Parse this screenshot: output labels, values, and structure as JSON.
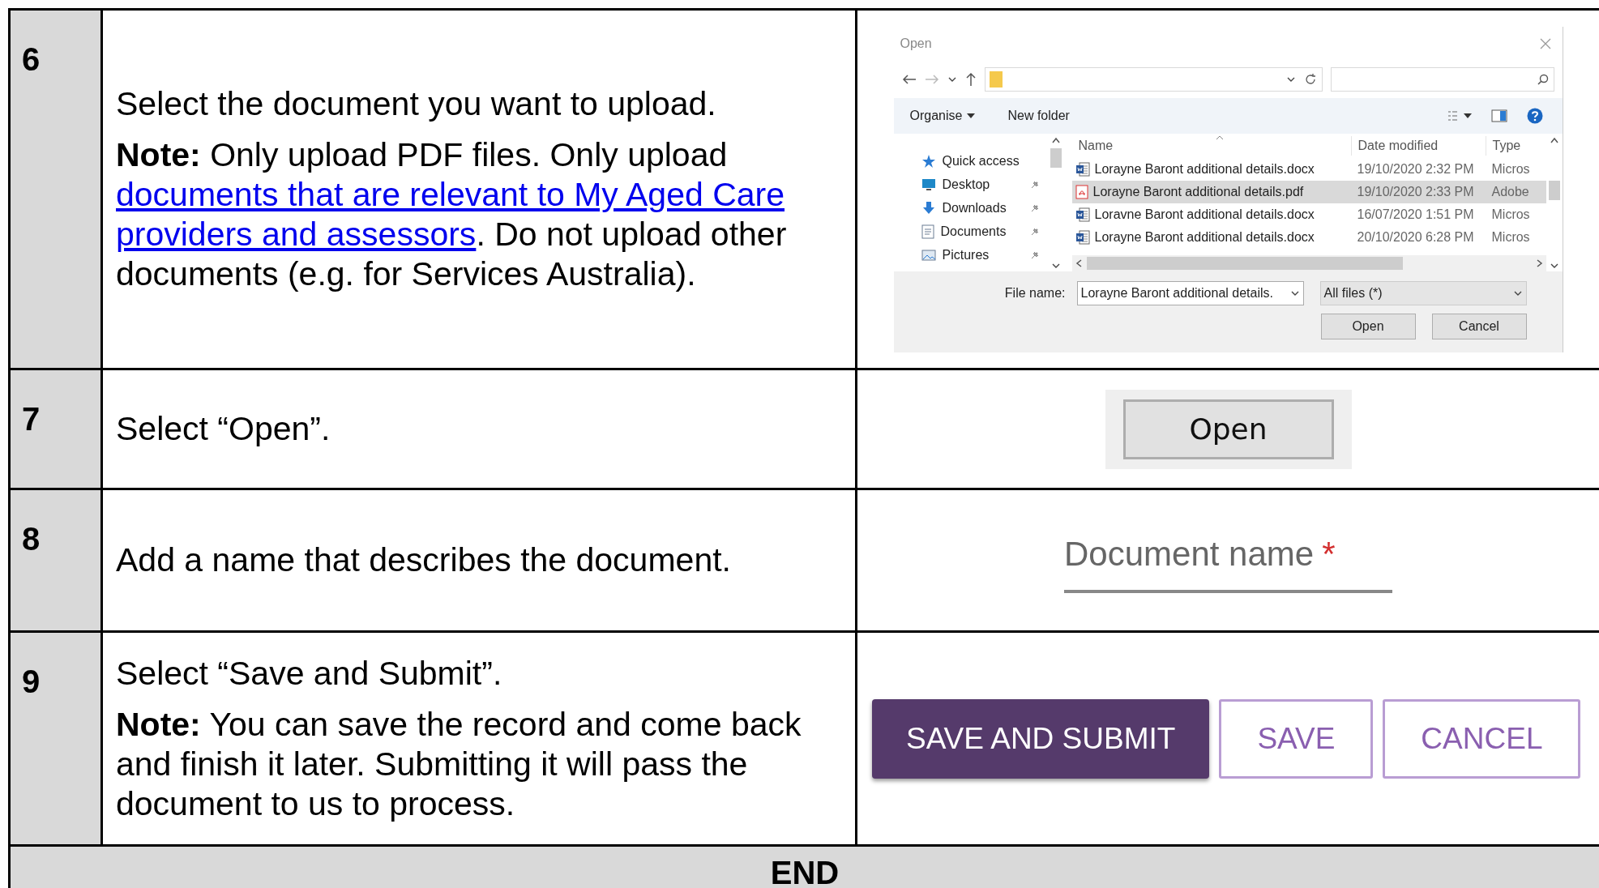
{
  "steps": [
    {
      "number": "6",
      "paragraphs": [
        [
          {
            "kind": "text",
            "text": "Select the document you want to upload."
          }
        ],
        [
          {
            "kind": "text",
            "text": "**Note:** Only upload PDF files. Only upload "
          },
          {
            "kind": "link",
            "text": "documents that are relevant to My Aged Care"
          },
          {
            "kind": "link",
            "text": "providers and assessors"
          },
          {
            "kind": "text",
            "text": ". Do not upload other documents (e.g. for Services Australia)."
          }
        ]
      ],
      "figure": {
        "kind": "file_dialog",
        "title": "Open",
        "organise": "Organise",
        "new_folder": "New folder",
        "nav": [
          {
            "label": "Quick access",
            "kind": "star",
            "pinned": false
          },
          {
            "label": "Desktop",
            "kind": "desktop",
            "pinned": true
          },
          {
            "label": "Downloads",
            "kind": "downloads",
            "pinned": true
          },
          {
            "label": "Documents",
            "kind": "documents",
            "pinned": true
          },
          {
            "label": "Pictures",
            "kind": "pictures",
            "pinned": true
          }
        ],
        "columns": [
          "Name",
          "Date modified",
          "Type"
        ],
        "files": [
          {
            "name": "Lorayne Baront additional details.docx",
            "date": "19/10/2020 2:32 PM",
            "type": "Micros",
            "kind": "docx",
            "selected": false
          },
          {
            "name": "Lorayne Baront additional details.pdf",
            "date": "19/10/2020 2:33 PM",
            "type": "Adobe",
            "kind": "pdf",
            "selected": true
          },
          {
            "name": "Loravne Baront additional details.docx",
            "date": "16/07/2020 1:51 PM",
            "type": "Micros",
            "kind": "docx",
            "selected": false
          },
          {
            "name": "Lorayne Baront additional details.docx",
            "date": "20/10/2020 6:28 PM",
            "type": "Micros",
            "kind": "docx",
            "selected": false
          }
        ],
        "file_name_label": "File name:",
        "file_name": "Lorayne Baront additional details.",
        "filter": "All files (*)",
        "buttons": [
          "Open",
          "Cancel"
        ]
      }
    },
    {
      "number": "7",
      "paragraphs": [
        [
          {
            "kind": "text",
            "text": "Select “Open”."
          }
        ]
      ],
      "figure": {
        "kind": "button",
        "label": "Open"
      }
    },
    {
      "number": "8",
      "paragraphs": [
        [
          {
            "kind": "text",
            "text": "Add a name that describes the document."
          }
        ]
      ],
      "figure": {
        "kind": "text_field",
        "placeholder": "Document name",
        "required_mark": "*"
      }
    },
    {
      "number": "9",
      "paragraphs": [
        [
          {
            "kind": "text",
            "text": "Select “Save and Submit”."
          }
        ],
        [
          {
            "kind": "text",
            "text": "**Note:** You can save the record and come back and finish it later. Submitting it will pass the document to us to process."
          }
        ]
      ],
      "figure": {
        "kind": "button_group",
        "buttons": [
          {
            "label": "SAVE AND SUBMIT",
            "primary": true
          },
          {
            "label": "SAVE",
            "primary": false
          },
          {
            "label": "CANCEL",
            "primary": false
          }
        ]
      }
    }
  ],
  "end": "END"
}
